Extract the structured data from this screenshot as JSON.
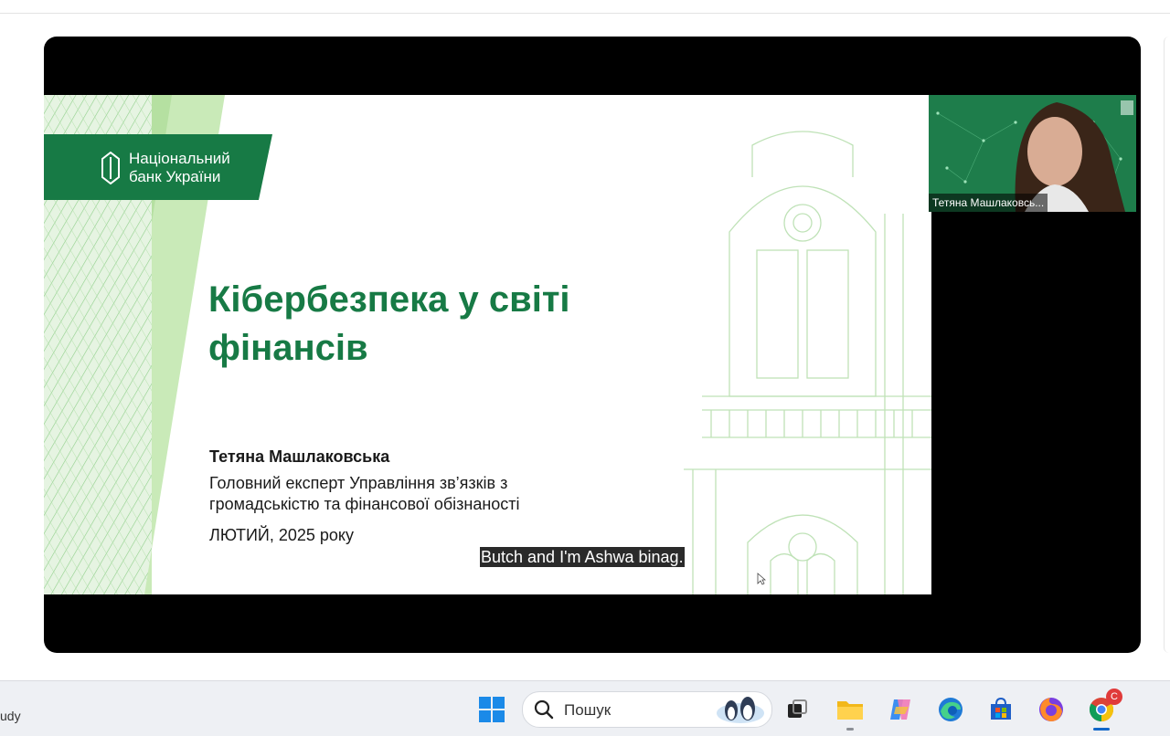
{
  "slide": {
    "logo_line1": "Національний",
    "logo_line2": "банк України",
    "title": "Кібербезпека у світі фінансів",
    "speaker_name": "Тетяна Машлаковська",
    "speaker_role": "Головний експерт Управління зв’язків з громадськістю та фінансової обізнаності",
    "date": "ЛЮТИЙ, 2025 року"
  },
  "caption": "Butch and I'm Ashwa binag.",
  "participant": {
    "name": "Тетяна Машлаковсь..."
  },
  "taskbar": {
    "left_text": "udy",
    "search_placeholder": "Пошук",
    "chrome_badge": "C",
    "icons": [
      "windows-start-icon",
      "search-icon",
      "task-view-icon",
      "file-explorer-icon",
      "copilot-icon",
      "edge-icon",
      "microsoft-store-icon",
      "firefox-icon",
      "chrome-icon"
    ]
  },
  "colors": {
    "brand_green": "#177a45",
    "player_background": "#000000",
    "taskbar_background": "#eef0f4"
  }
}
